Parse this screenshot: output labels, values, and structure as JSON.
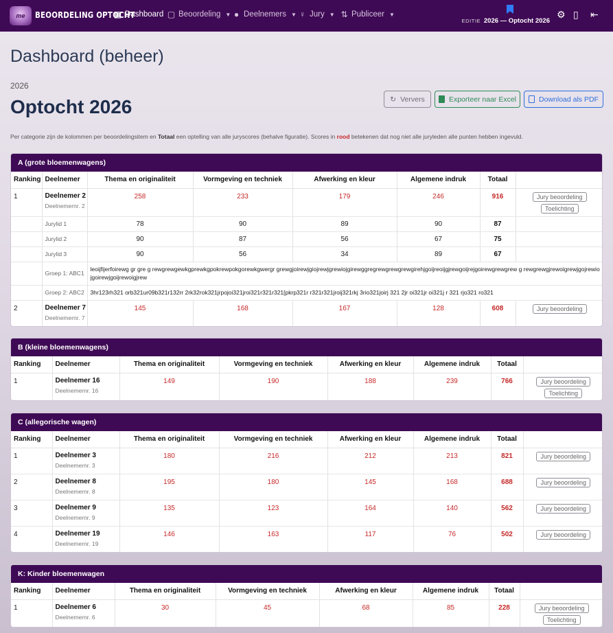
{
  "nav": {
    "logo_text": "me",
    "brand": "BEOORDELING OPTOCHT",
    "items": [
      {
        "label": "Dashboard",
        "icon": "grid-icon",
        "active": true
      },
      {
        "label": "Beoordeling",
        "icon": "clipboard-icon",
        "dropdown": true
      },
      {
        "label": "Deelnemers",
        "icon": "users-icon",
        "dropdown": true
      },
      {
        "label": "Jury",
        "icon": "lightbulb-icon",
        "dropdown": true
      },
      {
        "label": "Publiceer",
        "icon": "sort-icon",
        "dropdown": true
      }
    ],
    "edition_label": "EDITIE",
    "edition_value": "2026 — Optocht 2026",
    "right_icons": [
      "bookmark-icon",
      "gear-icon",
      "book-icon",
      "logout-icon"
    ]
  },
  "page": {
    "title": "Dashboard (beheer)",
    "year": "2026",
    "event_title": "Optocht 2026",
    "buttons": {
      "refresh": "Ververs",
      "excel": "Exporteer naar Excel",
      "pdf": "Download als PDF"
    },
    "note_1": "Per categorie zijn de kolommen per beoordelingsitem en ",
    "note_bold": "Totaal",
    "note_2": " een optelling van alle juryscores (behalve figuratie). Scores in ",
    "note_red": "rood",
    "note_3": " betekenen dat nog niet alle juryleden alle punten hebben ingevuld."
  },
  "columns": {
    "ranking": "Ranking",
    "participant": "Deelnemer",
    "c1": "Thema en originaliteit",
    "c2": "Vormgeving en techniek",
    "c3": "Afwerking en kleur",
    "c4": "Algemene indruk",
    "total": "Totaal"
  },
  "actions": {
    "jury": "Jury beoordeling",
    "explain": "Toelichting"
  },
  "categories": {
    "a": {
      "title": "A (grote bloemenwagens)",
      "rows": [
        {
          "rank": "1",
          "name": "Deelnemer 2",
          "nr": "Deelnemernr. 2",
          "scores": [
            "258",
            "233",
            "179",
            "246"
          ],
          "total": "916",
          "jury": [
            {
              "label": "Jurylid 1",
              "scores": [
                "78",
                "90",
                "89",
                "90"
              ],
              "total": "87"
            },
            {
              "label": "Jurylid 2",
              "scores": [
                "90",
                "87",
                "56",
                "67"
              ],
              "total": "75"
            },
            {
              "label": "Jurylid 3",
              "scores": [
                "90",
                "56",
                "34",
                "89"
              ],
              "total": "67"
            }
          ],
          "groups": [
            {
              "label": "Groep 1: ABC1",
              "text": "leoijfijerfoirewg gr gre g rewgrewgewkgprewkgpokrewpokgorewkgwergr grewgjoirewjgiojrewjgrewiojgirewggregrewgrewgrewgirehjgoijreoijgjrewgoijrejgoirewgrewgrew g rewgrewgjrewoigrewjgojrewiojgoirewjgoijrewoigjrew"
            },
            {
              "label": "Groep 2: ABC2",
              "text": "3hr123rh321 orb321ur09b321r132rr 2rk32rok321jrpojoi321jroi321r321r321[pkrp321r r321r321jroij321rkj 3rio321joirj 321 2jr oi321jr oi321j r 321 rjo321 ro321"
            }
          ]
        },
        {
          "rank": "2",
          "name": "Deelnemer 7",
          "nr": "Deelnemernr. 7",
          "scores": [
            "145",
            "168",
            "167",
            "128"
          ],
          "total": "608"
        }
      ]
    },
    "b": {
      "title": "B (kleine bloemenwagens)",
      "rows": [
        {
          "rank": "1",
          "name": "Deelnemer 16",
          "nr": "Deelnemernr. 16",
          "scores": [
            "149",
            "190",
            "188",
            "239"
          ],
          "total": "766"
        }
      ]
    },
    "c": {
      "title": "C (allegorische wagen)",
      "rows": [
        {
          "rank": "1",
          "name": "Deelnemer 3",
          "nr": "Deelnemernr. 3",
          "scores": [
            "180",
            "216",
            "212",
            "213"
          ],
          "total": "821"
        },
        {
          "rank": "2",
          "name": "Deelnemer 8",
          "nr": "Deelnemernr. 8",
          "scores": [
            "195",
            "180",
            "145",
            "168"
          ],
          "total": "688"
        },
        {
          "rank": "3",
          "name": "Deelnemer 9",
          "nr": "Deelnemernr. 9",
          "scores": [
            "135",
            "123",
            "164",
            "140"
          ],
          "total": "562"
        },
        {
          "rank": "4",
          "name": "Deelnemer 19",
          "nr": "Deelnemernr. 19",
          "scores": [
            "146",
            "163",
            "117",
            "76"
          ],
          "total": "502"
        }
      ]
    },
    "k": {
      "title": "K: Kinder bloemenwagen",
      "rows": [
        {
          "rank": "1",
          "name": "Deelnemer 6",
          "nr": "Deelnemernr. 6",
          "scores": [
            "30",
            "45",
            "68",
            "85"
          ],
          "total": "228"
        }
      ]
    }
  },
  "colors": {
    "navbar": "#3f0a55",
    "incomplete_score": "#c62828",
    "excel": "#2e8b57",
    "pdf": "#2f6fdc"
  }
}
